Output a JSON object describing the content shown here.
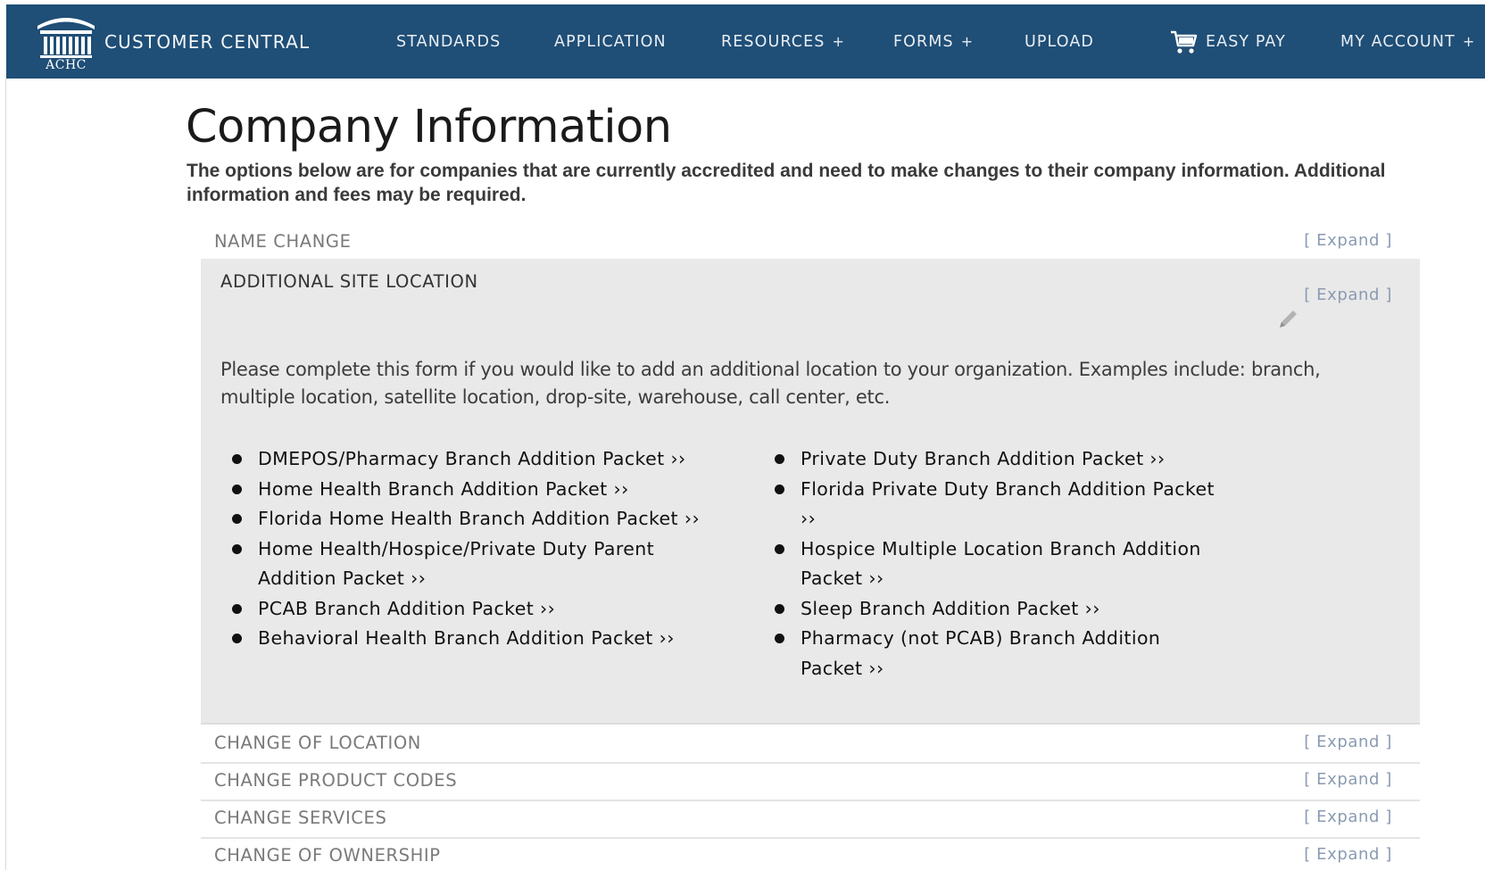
{
  "nav": {
    "logo_text": "ACHC",
    "brand": "CUSTOMER CENTRAL",
    "items": [
      {
        "label": "STANDARDS",
        "plus": ""
      },
      {
        "label": "APPLICATION",
        "plus": ""
      },
      {
        "label": "RESOURCES",
        "plus": "+"
      },
      {
        "label": "FORMS",
        "plus": "+"
      },
      {
        "label": "UPLOAD",
        "plus": ""
      },
      {
        "label": "EASY PAY",
        "plus": "",
        "icon": "shopping-cart-icon"
      },
      {
        "label": "MY ACCOUNT",
        "plus": "+"
      }
    ]
  },
  "page": {
    "title": "Company Information",
    "intro": "The options below are for companies that are currently accredited and need to make changes to their company information. Additional information and fees may be required."
  },
  "accordion": {
    "expand_label": "[ Expand ]",
    "sections": [
      {
        "title": "NAME CHANGE",
        "expanded": false
      },
      {
        "title": "ADDITIONAL SITE LOCATION",
        "expanded": true,
        "edit_icon": "pencil-icon",
        "description": "Please complete this form if you would like to add an additional location to your organization. Examples include: branch, multiple location, satellite location, drop-site, warehouse, call center, etc.",
        "packets_left": [
          "DMEPOS/Pharmacy Branch Addition Packet ››",
          "Home Health Branch Addition Packet ››",
          "Florida Home Health Branch Addition Packet ››",
          "Home Health/Hospice/Private Duty Parent Addition Packet ››",
          "PCAB Branch Addition Packet ››",
          "Behavioral Health Branch Addition Packet ››"
        ],
        "packets_right": [
          "Private Duty Branch Addition Packet ››",
          "Florida Private Duty Branch Addition Packet ››",
          "Hospice Multiple Location Branch Addition Packet ››",
          "Sleep Branch Addition Packet ››",
          "Pharmacy (not PCAB) Branch Addition Packet ››"
        ]
      },
      {
        "title": "CHANGE OF LOCATION",
        "expanded": false
      },
      {
        "title": "CHANGE PRODUCT CODES",
        "expanded": false
      },
      {
        "title": "CHANGE SERVICES",
        "expanded": false
      },
      {
        "title": "CHANGE OF OWNERSHIP",
        "expanded": false
      }
    ]
  },
  "colors": {
    "nav_background": "#1f4e76",
    "panel_background": "#e9e9e9",
    "expand_link": "#8a9bb2"
  }
}
